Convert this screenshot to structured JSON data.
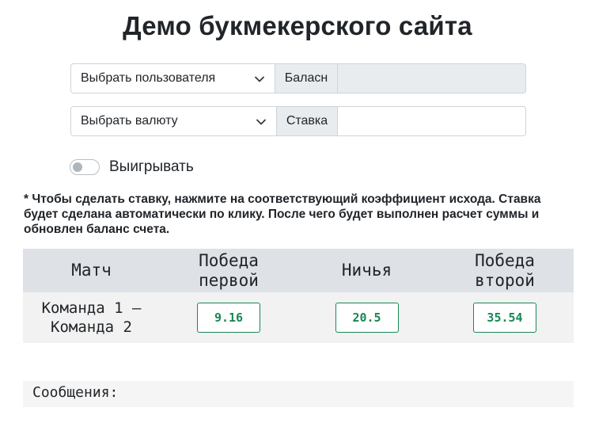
{
  "page": {
    "title": "Демо букмекерского сайта"
  },
  "user_row": {
    "select_value": "Выбрать пользователя",
    "addon_label": "Баласн",
    "balance_value": ""
  },
  "currency_row": {
    "select_value": "Выбрать валюту",
    "addon_label": "Ставка",
    "stake_value": ""
  },
  "toggle": {
    "label": "Выигрывать",
    "checked": false
  },
  "note": "* Чтобы сделать ставку, нажмите на соответствующий коэффициент исхода. Ставка будет сделана автоматически по клику. После чего будет выполнен расчет суммы и обновлен баланс счета.",
  "table": {
    "headers": [
      "Матч",
      "Победа первой",
      "Ничья",
      "Победа второй"
    ],
    "rows": [
      {
        "match": "Команда 1 – Команда 2",
        "odds": [
          "9.16",
          "20.5",
          "35.54"
        ]
      }
    ]
  },
  "messages": {
    "label": "Сообщения:"
  },
  "colors": {
    "accent": "#198754",
    "header_bg": "#dee2e6",
    "addon_bg": "#e9ecef"
  }
}
